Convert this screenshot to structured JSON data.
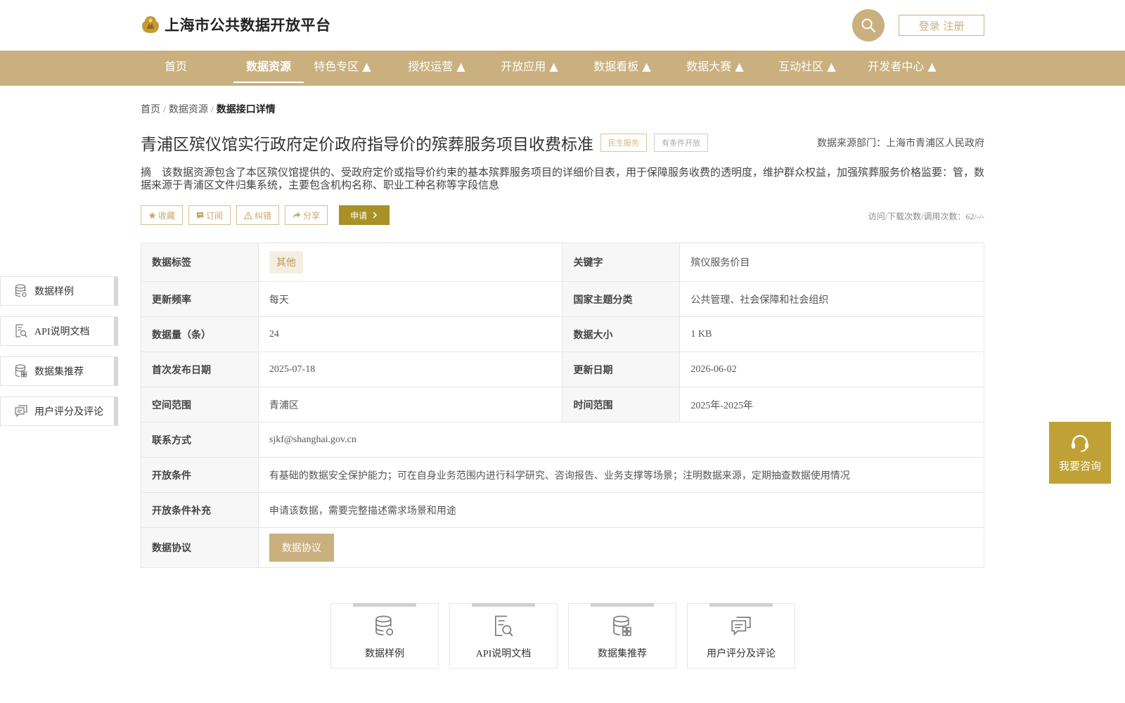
{
  "header": {
    "site_title": "上海市公共数据开放平台",
    "login_label": "登录 注册"
  },
  "nav": {
    "items": [
      {
        "label": "首页"
      },
      {
        "label": "数据资源"
      },
      {
        "label": "特色专区 ▲"
      },
      {
        "label": "授权运营 ▲"
      },
      {
        "label": "开放应用 ▲"
      },
      {
        "label": "数据看板 ▲"
      },
      {
        "label": "数据大赛 ▲"
      },
      {
        "label": "互动社区 ▲"
      },
      {
        "label": "开发者中心 ▲"
      }
    ],
    "active_index": 1
  },
  "breadcrumb": {
    "home": "首页",
    "section": "数据资源",
    "current": "数据接口详情",
    "separator": "/"
  },
  "dataset": {
    "title": "青浦区殡仪馆实行政府定价政府指导价的殡葬服务项目收费标准",
    "tag_category": "民生服务",
    "tag_open": "有条件开放",
    "source_label": "数据来源部门：上海市青浦区人民政府",
    "summary": "摘　该数据资源包含了本区殡仪馆提供的、受政府定价或指导价约束的基本殡葬服务项目的详细价目表，用于保障服务收费的透明度，维护群众权益，加强殡葬服务价格监要：管，数据来源于青浦区文件归集系统，主要包含机构名称、职业工种名称等字段信息",
    "visits": "访问/下载次数/调用次数：62/-/-"
  },
  "actions": {
    "favorite": "收藏",
    "subscribe": "订阅",
    "report": "纠错",
    "share": "分享",
    "apply": "申请"
  },
  "sidebar": {
    "items": [
      {
        "label": "数据样例"
      },
      {
        "label": "API说明文档"
      },
      {
        "label": "数据集推荐"
      },
      {
        "label": "用户评分及评论"
      }
    ]
  },
  "info": {
    "tag_label": "数据标签",
    "tag_value": "其他",
    "keyword_label": "关键字",
    "keyword_value": "殡仪服务价目",
    "freq_label": "更新频率",
    "freq_value": "每天",
    "theme_label": "国家主题分类",
    "theme_value": "公共管理、社会保障和社会组织",
    "count_label": "数据量（条）",
    "count_value": "24",
    "size_label": "数据大小",
    "size_value": "1 KB",
    "first_pub_label": "首次发布日期",
    "first_pub_value": "2025-07-18",
    "update_label": "更新日期",
    "update_value": "2026-06-02",
    "space_label": "空间范围",
    "space_value": "青浦区",
    "time_label": "时间范围",
    "time_value": "2025年-2025年",
    "contact_label": "联系方式",
    "contact_value": "sjkf@shanghai.gov.cn",
    "cond_label": "开放条件",
    "cond_value": "有基础的数据安全保护能力；可在自身业务范围内进行科学研究、咨询报告、业务支撑等场景；注明数据来源，定期抽查数据使用情况",
    "cond_extra_label": "开放条件补充",
    "cond_extra_value": "申请该数据，需要完整描述需求场景和用途",
    "protocol_label": "数据协议",
    "protocol_button": "数据协议"
  },
  "cards": {
    "items": [
      {
        "label": "数据样例"
      },
      {
        "label": "API说明文档"
      },
      {
        "label": "数据集推荐"
      },
      {
        "label": "用户评分及评论"
      }
    ]
  },
  "consult": {
    "label": "我要咨询"
  },
  "colors": {
    "brand": "#c9b07e",
    "apply": "#a99126",
    "consult": "#bfa135"
  }
}
